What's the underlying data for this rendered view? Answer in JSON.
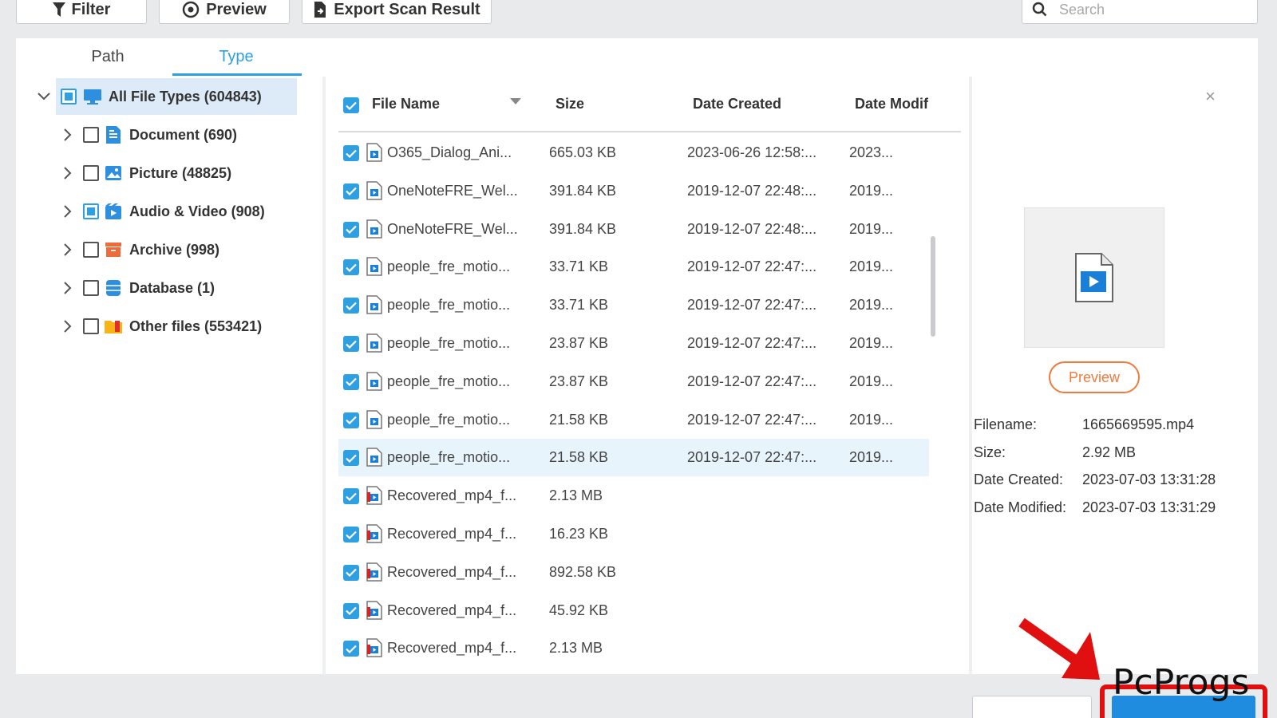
{
  "toolbar": {
    "filter_label": "Filter",
    "preview_label": "Preview",
    "export_label": "Export Scan Result",
    "search_placeholder": "Search"
  },
  "tabs": {
    "path": "Path",
    "type": "Type"
  },
  "tree": {
    "root": {
      "label": "All File Types (604843)",
      "state": "partial"
    },
    "items": [
      {
        "label": "Document (690)",
        "icon": "document-icon",
        "state": "unchecked"
      },
      {
        "label": "Picture (48825)",
        "icon": "picture-icon",
        "state": "unchecked"
      },
      {
        "label": "Audio & Video (908)",
        "icon": "video-icon",
        "state": "partial"
      },
      {
        "label": "Archive (998)",
        "icon": "archive-icon",
        "state": "unchecked"
      },
      {
        "label": "Database (1)",
        "icon": "database-icon",
        "state": "unchecked"
      },
      {
        "label": "Other files (553421)",
        "icon": "folder-icon",
        "state": "unchecked"
      }
    ]
  },
  "table": {
    "headers": {
      "name": "File Name",
      "size": "Size",
      "created": "Date Created",
      "modified": "Date Modif"
    },
    "rows": [
      {
        "name": "O365_Dialog_Ani...",
        "size": "665.03 KB",
        "created": "2023-06-26 12:58:...",
        "modified": "2023...",
        "icon": "video-file-icon"
      },
      {
        "name": "OneNoteFRE_Wel...",
        "size": "391.84 KB",
        "created": "2019-12-07 22:48:...",
        "modified": "2019...",
        "icon": "video-file-icon"
      },
      {
        "name": "OneNoteFRE_Wel...",
        "size": "391.84 KB",
        "created": "2019-12-07 22:48:...",
        "modified": "2019...",
        "icon": "video-file-icon"
      },
      {
        "name": "people_fre_motio...",
        "size": "33.71 KB",
        "created": "2019-12-07 22:47:...",
        "modified": "2019...",
        "icon": "video-file-icon"
      },
      {
        "name": "people_fre_motio...",
        "size": "33.71 KB",
        "created": "2019-12-07 22:47:...",
        "modified": "2019...",
        "icon": "video-file-icon"
      },
      {
        "name": "people_fre_motio...",
        "size": "23.87 KB",
        "created": "2019-12-07 22:47:...",
        "modified": "2019...",
        "icon": "video-file-icon"
      },
      {
        "name": "people_fre_motio...",
        "size": "23.87 KB",
        "created": "2019-12-07 22:47:...",
        "modified": "2019...",
        "icon": "video-file-icon"
      },
      {
        "name": "people_fre_motio...",
        "size": "21.58 KB",
        "created": "2019-12-07 22:47:...",
        "modified": "2019...",
        "icon": "video-file-icon"
      },
      {
        "name": "people_fre_motio...",
        "size": "21.58 KB",
        "created": "2019-12-07 22:47:...",
        "modified": "2019...",
        "icon": "video-file-icon",
        "highlighted": true
      },
      {
        "name": "Recovered_mp4_f...",
        "size": "2.13 MB",
        "created": "",
        "modified": "",
        "icon": "recovered-video-file-icon"
      },
      {
        "name": "Recovered_mp4_f...",
        "size": "16.23 KB",
        "created": "",
        "modified": "",
        "icon": "recovered-video-file-icon"
      },
      {
        "name": "Recovered_mp4_f...",
        "size": "892.58 KB",
        "created": "",
        "modified": "",
        "icon": "recovered-video-file-icon"
      },
      {
        "name": "Recovered_mp4_f...",
        "size": "45.92 KB",
        "created": "",
        "modified": "",
        "icon": "recovered-video-file-icon"
      },
      {
        "name": "Recovered_mp4_f...",
        "size": "2.13 MB",
        "created": "",
        "modified": "",
        "icon": "recovered-video-file-icon"
      }
    ]
  },
  "preview_pane": {
    "close": "×",
    "preview_button": "Preview",
    "info": [
      {
        "label": "Filename:",
        "value": "1665669595.mp4"
      },
      {
        "label": "Size:",
        "value": "2.92 MB"
      },
      {
        "label": "Date Created:",
        "value": "2023-07-03 13:31:28"
      },
      {
        "label": "Date Modified:",
        "value": "2023-07-03 13:31:29"
      }
    ]
  },
  "watermark": "PcProgs",
  "colors": {
    "accent": "#2e9fe0",
    "preview": "#f07a3c",
    "annotation": "#e01010"
  }
}
